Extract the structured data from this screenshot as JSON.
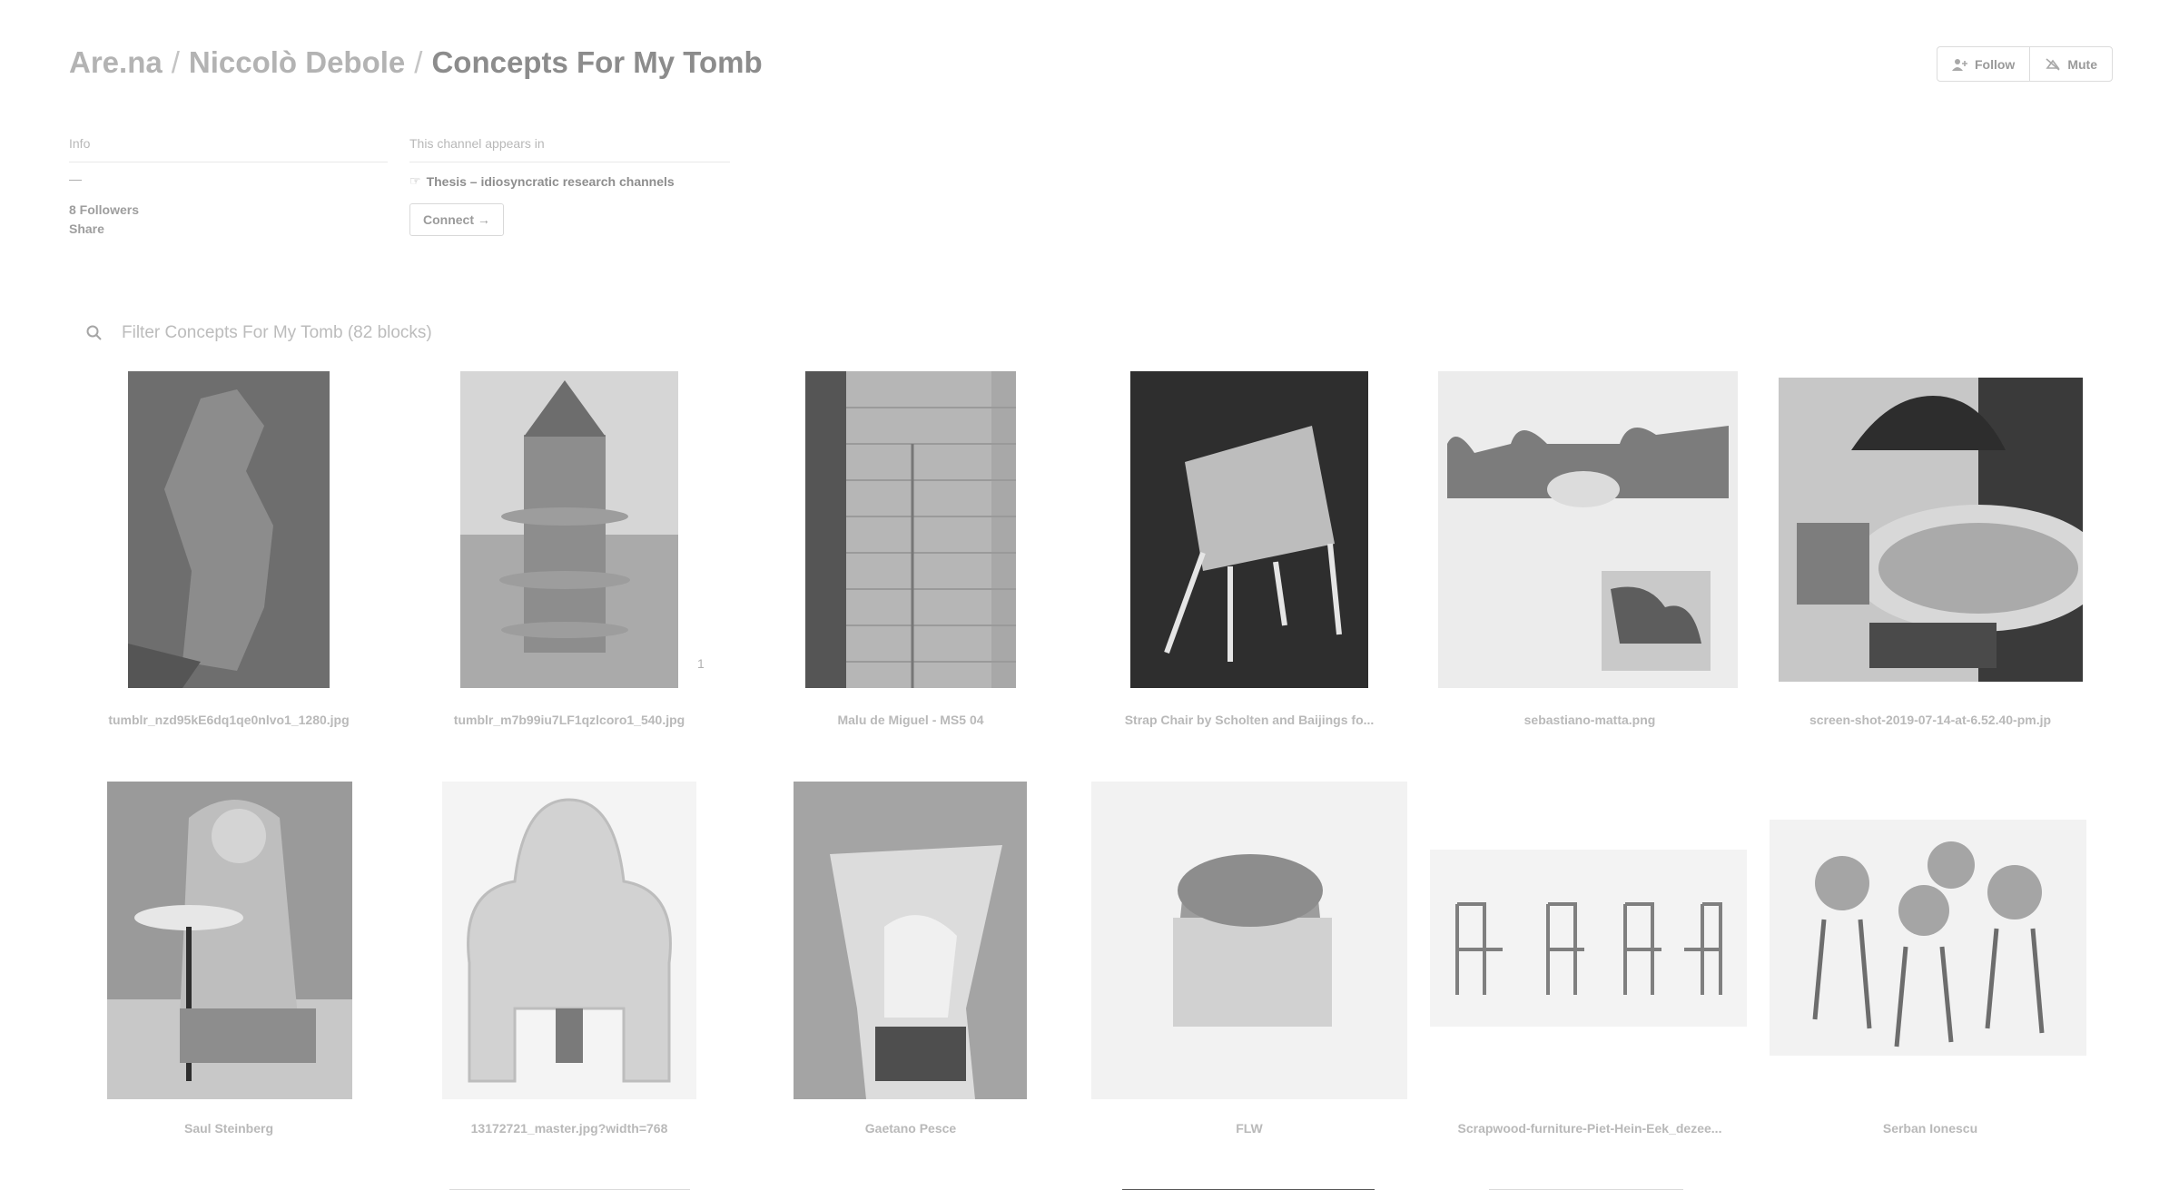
{
  "breadcrumb": {
    "site": "Are.na",
    "separator": "/",
    "user": "Niccolò Debole",
    "channel": "Concepts For My Tomb"
  },
  "actions": {
    "follow": "Follow",
    "mute": "Mute"
  },
  "info": {
    "heading": "Info",
    "dash": "—",
    "followers": "8 Followers",
    "share": "Share"
  },
  "appears": {
    "heading": "This channel appears in",
    "icon": "pointing-hand",
    "item": "Thesis – idiosyncratic research channels",
    "connect": "Connect →"
  },
  "filter": {
    "placeholder": "Filter Concepts For My Tomb (82 blocks)"
  },
  "blocks": [
    {
      "caption": "tumblr_nzd95kE6dq1qe0nlvo1_1280.jpg"
    },
    {
      "caption": "tumblr_m7b99iu7LF1qzlcoro1_540.jpg",
      "badge": "1"
    },
    {
      "caption": "Malu de Miguel - MS5 04"
    },
    {
      "caption": "Strap Chair by Scholten and Baijings fo..."
    },
    {
      "caption": "sebastiano-matta.png"
    },
    {
      "caption": "screen-shot-2019-07-14-at-6.52.40-pm.jp"
    },
    {
      "caption": "Saul Steinberg"
    },
    {
      "caption": "13172721_master.jpg?width=768"
    },
    {
      "caption": "Gaetano Pesce"
    },
    {
      "caption": "FLW"
    },
    {
      "caption": "Scrapwood-furniture-Piet-Hein-Eek_dezee..."
    },
    {
      "caption": "Serban Ionescu"
    }
  ]
}
